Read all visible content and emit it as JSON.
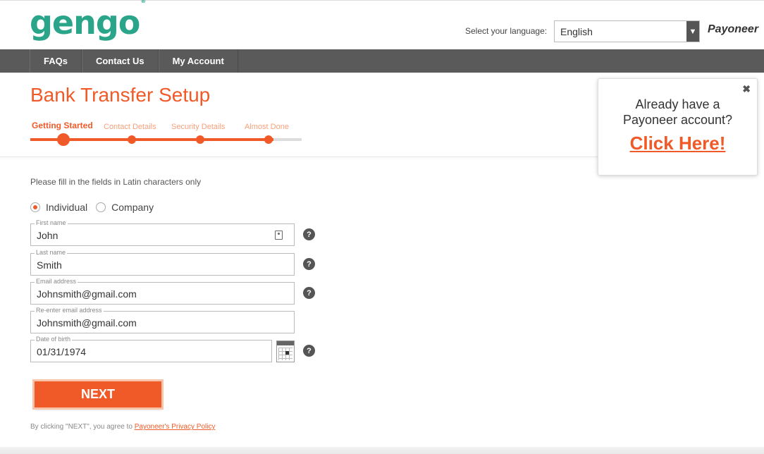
{
  "header": {
    "logo_text": "gengo",
    "logo_mark": "®",
    "language_label": "Select your language:",
    "language_value": "English",
    "payoneer_logo": "Payoneer"
  },
  "nav": {
    "items": [
      {
        "label": "FAQs"
      },
      {
        "label": "Contact Us"
      },
      {
        "label": "My Account"
      }
    ]
  },
  "page": {
    "title": "Bank Transfer Setup"
  },
  "steps": [
    {
      "label": "Getting Started",
      "active": true
    },
    {
      "label": "Contact Details",
      "active": false
    },
    {
      "label": "Security Details",
      "active": false
    },
    {
      "label": "Almost Done",
      "active": false
    }
  ],
  "popup": {
    "line1": "Already have a",
    "line2": "Payoneer account?",
    "cta": "Click Here!",
    "close_icon": "close-icon"
  },
  "form": {
    "instructions": "Please fill in the fields in Latin characters only",
    "account_type": {
      "options": [
        "Individual",
        "Company"
      ],
      "selected": "Individual"
    },
    "first_name": {
      "label": "First name",
      "value": "John"
    },
    "last_name": {
      "label": "Last name",
      "value": "Smith"
    },
    "email": {
      "label": "Email address",
      "value": "Johnsmith@gmail.com"
    },
    "reenter_email": {
      "label": "Re-enter email address",
      "value": "Johnsmith@gmail.com"
    },
    "dob": {
      "label": "Date of birth",
      "value": "01/31/1974"
    },
    "help_glyph": "?",
    "next_label": "NEXT",
    "legal_prefix": "By clicking \"NEXT\", you agree to ",
    "legal_link": "Payoneer's Privacy Policy"
  },
  "colors": {
    "accent": "#f05a28",
    "nav_bg": "#5a5a5a",
    "logo_green": "#2aa58a"
  }
}
